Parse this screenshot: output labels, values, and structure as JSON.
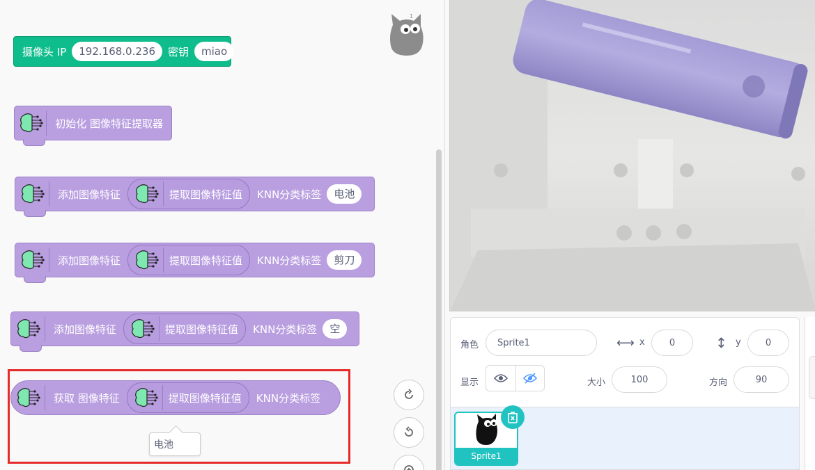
{
  "blocks": {
    "camera": {
      "label": "摄像头 IP",
      "ip": "192.168.0.236",
      "key_label": "密钥",
      "key": "miao"
    },
    "init": {
      "label": "初始化 图像特征提取器"
    },
    "add1": {
      "label": "添加图像特征",
      "reporter": "提取图像特征值",
      "knn_label": "KNN分类标签",
      "tag": "电池"
    },
    "add2": {
      "label": "添加图像特征",
      "reporter": "提取图像特征值",
      "knn_label": "KNN分类标签",
      "tag": "剪刀"
    },
    "add3": {
      "label": "添加图像特征",
      "reporter": "提取图像特征值",
      "knn_label": "KNN分类标签",
      "tag": "空"
    },
    "get": {
      "label": "获取 图像特征",
      "reporter": "提取图像特征值",
      "knn_label": "KNN分类标签"
    },
    "result_tooltip": "电池"
  },
  "sprite_info": {
    "sprite_label": "角色",
    "sprite_name": "Sprite1",
    "x_label": "x",
    "x_value": "0",
    "y_label": "y",
    "y_value": "0",
    "show_label": "显示",
    "size_label": "大小",
    "size_value": "100",
    "direction_label": "方向",
    "direction_value": "90"
  },
  "sprite_list": [
    {
      "name": "Sprite1"
    }
  ],
  "colors": {
    "looks_purple": "#b99ee0",
    "green": "#0fbd8c",
    "accent": "#21c3c1",
    "highlight": "#e52a2a"
  }
}
